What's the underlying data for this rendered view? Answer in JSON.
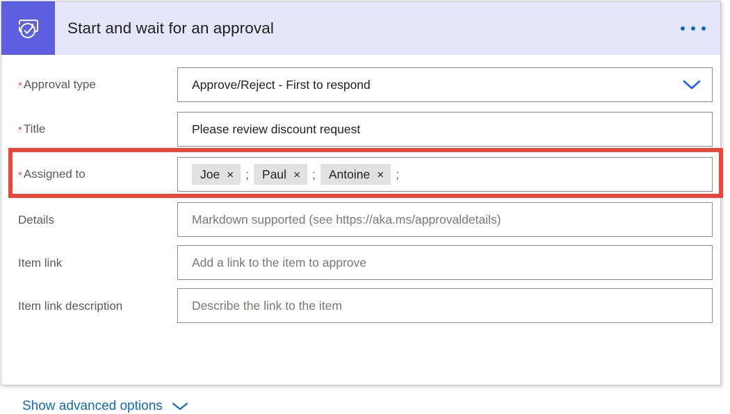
{
  "header": {
    "title": "Start and wait for an approval",
    "icon": "approval-flow-icon",
    "overflow_menu": "ellipsis-menu",
    "accent_color": "#5b5fe0",
    "background_color": "#e6e6fa"
  },
  "fields": [
    {
      "id": "approval-type",
      "label": "Approval type",
      "required": true,
      "value": "Approve/Reject - First to respond",
      "control": "dropdown",
      "icon": "chevron-down-icon"
    },
    {
      "id": "title",
      "label": "Title",
      "required": true,
      "value": "Please review discount request",
      "control": "text"
    },
    {
      "id": "assigned-to",
      "label": "Assigned to",
      "required": true,
      "control": "people-picker",
      "highlighted": true,
      "chips": [
        {
          "name": "Joe",
          "remove": "×"
        },
        {
          "name": "Paul",
          "remove": "×"
        },
        {
          "name": "Antoine",
          "remove": "×"
        }
      ],
      "separator": ";",
      "trailing_separator": ";"
    },
    {
      "id": "details",
      "label": "Details",
      "required": false,
      "placeholder": "Markdown supported (see https://aka.ms/approvaldetails)",
      "control": "text"
    },
    {
      "id": "item-link",
      "label": "Item link",
      "required": false,
      "placeholder": "Add a link to the item to approve",
      "control": "text"
    },
    {
      "id": "item-link-description",
      "label": "Item link description",
      "required": false,
      "placeholder": "Describe the link to the item",
      "control": "text"
    }
  ],
  "advanced": {
    "label": "Show advanced options",
    "icon": "chevron-down-icon",
    "color": "#0f6cbd"
  },
  "highlight": {
    "color": "#f04438",
    "target": "assigned-to"
  }
}
